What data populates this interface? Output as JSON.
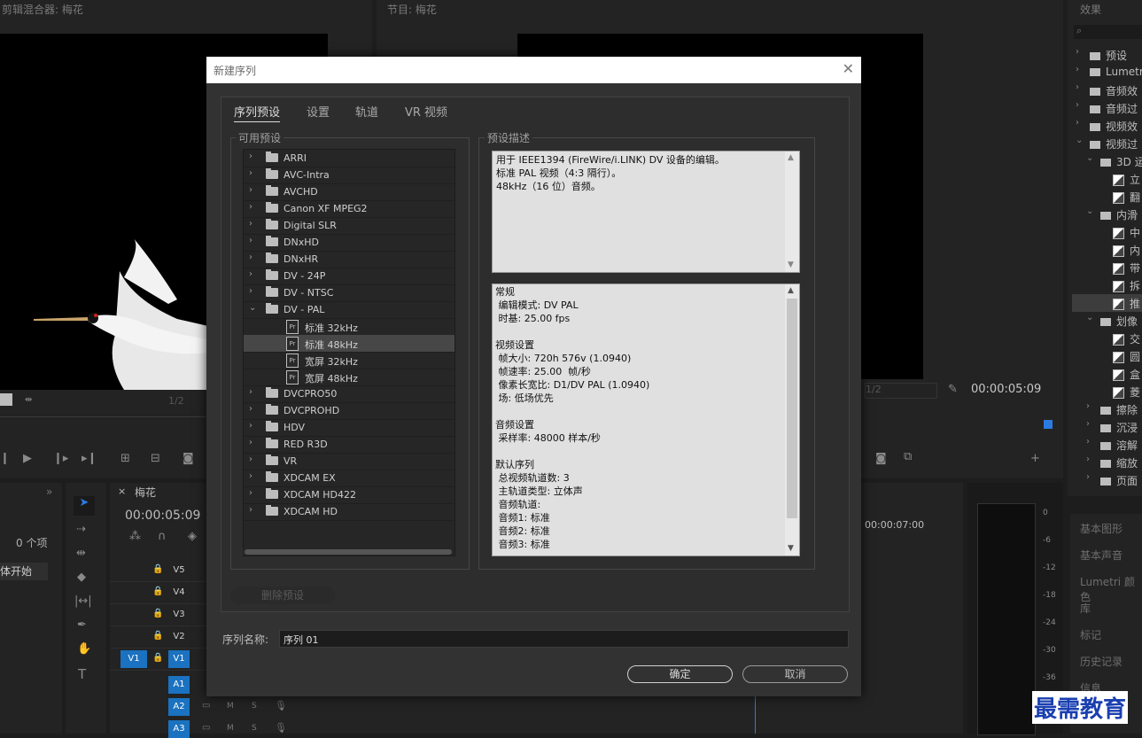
{
  "background": {
    "mixer_title": "剪辑混合器: 梅花",
    "program_title": "节目: 梅花",
    "effects_title": "效果",
    "source_fraction": "1/2",
    "program_fraction": "1/2",
    "program_timecode": "00:00:05:09",
    "timeline_tab": "梅花",
    "timeline_timecode": "00:00:05:09",
    "ruler_time": "00:00:07:00",
    "project_count": "0 个项",
    "project_item": "体开始",
    "video_tracks": [
      "V5",
      "V4",
      "V3",
      "V2",
      "V1"
    ],
    "source_v1": "V1",
    "audio_tracks": [
      "A1",
      "A2",
      "A3"
    ],
    "audio_ms": [
      "M",
      "S"
    ],
    "meter_ticks": [
      "0",
      "-6",
      "-12",
      "-18",
      "-24",
      "-30",
      "-36"
    ],
    "effects_tree": [
      {
        "type": "folder",
        "label": "预设",
        "indent": 0
      },
      {
        "type": "folder",
        "label": "Lumetri",
        "indent": 0
      },
      {
        "type": "folder",
        "label": "音频效",
        "indent": 0
      },
      {
        "type": "folder",
        "label": "音频过",
        "indent": 0
      },
      {
        "type": "folder",
        "label": "视频效",
        "indent": 0
      },
      {
        "type": "folder",
        "label": "视频过",
        "indent": 0,
        "open": true
      },
      {
        "type": "folder",
        "label": "3D 运",
        "indent": 1,
        "open": true
      },
      {
        "type": "fx",
        "label": "立",
        "indent": 2
      },
      {
        "type": "fx",
        "label": "翻",
        "indent": 2
      },
      {
        "type": "folder",
        "label": "内滑",
        "indent": 1,
        "open": true
      },
      {
        "type": "fx",
        "label": "中",
        "indent": 2
      },
      {
        "type": "fx",
        "label": "内",
        "indent": 2
      },
      {
        "type": "fx",
        "label": "带",
        "indent": 2
      },
      {
        "type": "fx",
        "label": "拆",
        "indent": 2
      },
      {
        "type": "fx",
        "label": "推",
        "indent": 2,
        "selected": true
      },
      {
        "type": "folder",
        "label": "划像",
        "indent": 1,
        "open": true
      },
      {
        "type": "fx",
        "label": "交",
        "indent": 2
      },
      {
        "type": "fx",
        "label": "圆",
        "indent": 2
      },
      {
        "type": "fx",
        "label": "盒",
        "indent": 2
      },
      {
        "type": "fx",
        "label": "菱",
        "indent": 2
      },
      {
        "type": "folder",
        "label": "擦除",
        "indent": 1
      },
      {
        "type": "folder",
        "label": "沉浸",
        "indent": 1
      },
      {
        "type": "folder",
        "label": "溶解",
        "indent": 1
      },
      {
        "type": "folder",
        "label": "缩放",
        "indent": 1
      },
      {
        "type": "folder",
        "label": "页面",
        "indent": 1
      }
    ],
    "side_panels": [
      "基本图形",
      "基本声音",
      "Lumetri 颜色",
      "库",
      "标记",
      "历史记录",
      "信息"
    ],
    "watermark": "最需教育"
  },
  "dialog": {
    "title": "新建序列",
    "tabs": [
      "序列预设",
      "设置",
      "轨道",
      "VR 视频"
    ],
    "available_presets_label": "可用预设",
    "preset_desc_label": "预设描述",
    "presets": [
      {
        "label": "ARRI",
        "kind": "folder"
      },
      {
        "label": "AVC-Intra",
        "kind": "folder"
      },
      {
        "label": "AVCHD",
        "kind": "folder"
      },
      {
        "label": "Canon XF MPEG2",
        "kind": "folder"
      },
      {
        "label": "Digital SLR",
        "kind": "folder"
      },
      {
        "label": "DNxHD",
        "kind": "folder"
      },
      {
        "label": "DNxHR",
        "kind": "folder"
      },
      {
        "label": "DV - 24P",
        "kind": "folder"
      },
      {
        "label": "DV - NTSC",
        "kind": "folder"
      },
      {
        "label": "DV - PAL",
        "kind": "folder",
        "open": true
      },
      {
        "label": "标准 32kHz",
        "kind": "preset"
      },
      {
        "label": "标准 48kHz",
        "kind": "preset",
        "selected": true
      },
      {
        "label": "宽屏 32kHz",
        "kind": "preset"
      },
      {
        "label": "宽屏 48kHz",
        "kind": "preset"
      },
      {
        "label": "DVCPRO50",
        "kind": "folder"
      },
      {
        "label": "DVCPROHD",
        "kind": "folder"
      },
      {
        "label": "HDV",
        "kind": "folder"
      },
      {
        "label": "RED R3D",
        "kind": "folder"
      },
      {
        "label": "VR",
        "kind": "folder"
      },
      {
        "label": "XDCAM EX",
        "kind": "folder"
      },
      {
        "label": "XDCAM HD422",
        "kind": "folder"
      },
      {
        "label": "XDCAM HD",
        "kind": "folder"
      }
    ],
    "description_lines": [
      "用于 IEEE1394 (FireWire/i.LINK) DV 设备的编辑。",
      "标准 PAL 视频（4:3 隔行）。",
      "48kHz（16 位）音频。"
    ],
    "details_lines": [
      "常规",
      " 编辑模式: DV PAL",
      " 时基: 25.00 fps",
      "",
      "视频设置",
      " 帧大小: 720h 576v (1.0940)",
      " 帧速率: 25.00  帧/秒",
      " 像素长宽比: D1/DV PAL (1.0940)",
      " 场: 低场优先",
      "",
      "音频设置",
      " 采样率: 48000 样本/秒",
      "",
      "默认序列",
      " 总视频轨道数: 3",
      " 主轨道类型: 立体声",
      " 音频轨道:",
      " 音频1: 标准",
      " 音频2: 标准",
      " 音频3: 标准"
    ],
    "delete_preset": "删除预设",
    "sequence_name_label": "序列名称:",
    "sequence_name_value": "序列 01",
    "ok": "确定",
    "cancel": "取消"
  }
}
